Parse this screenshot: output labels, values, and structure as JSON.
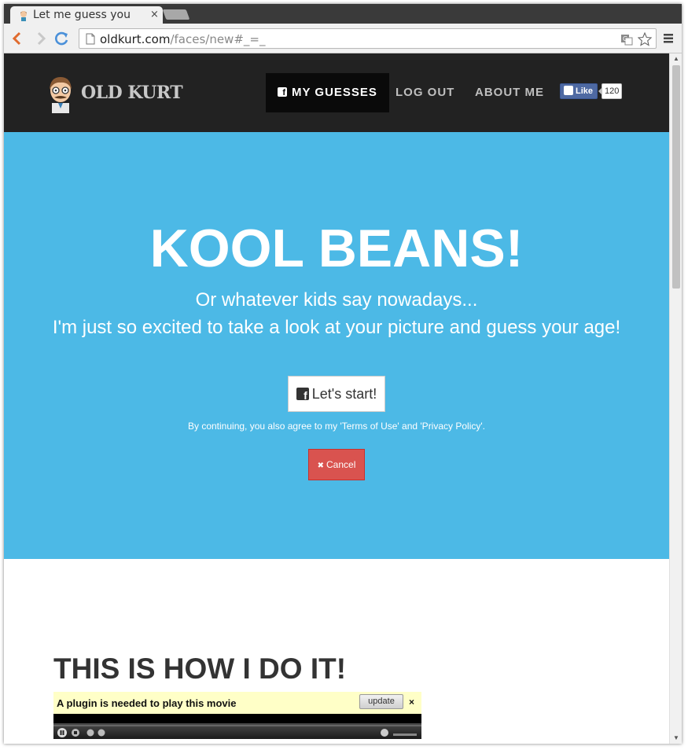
{
  "browser": {
    "tab_title": "Let me guess you",
    "tab_close": "×",
    "url_host": "oldkurt.com",
    "url_path": "/faces/new#_=_"
  },
  "nav": {
    "brand": "OLD KURT",
    "items": [
      {
        "label": "MY GUESSES",
        "active": true
      },
      {
        "label": "LOG OUT",
        "active": false
      },
      {
        "label": "ABOUT ME",
        "active": false
      }
    ],
    "fb_like_label": "Like",
    "fb_like_count": "120"
  },
  "hero": {
    "title": "KOOL BEANS!",
    "subtitle_line1": "Or whatever kids say nowadays...",
    "subtitle_line2": "I'm just so excited to take a look at your picture and guess your age!",
    "start_label": "Let's start!",
    "terms": "By continuing, you also agree to my 'Terms of Use' and 'Privacy Policy'.",
    "cancel_label": "Cancel",
    "cancel_icon": "✖"
  },
  "section": {
    "title": "THIS IS HOW I DO IT!",
    "plugin_message": "A plugin is needed to play this movie",
    "plugin_update": "update",
    "plugin_close": "×"
  },
  "colors": {
    "hero_bg": "#4cb9e6",
    "nav_bg": "#222222",
    "cancel": "#d9534f",
    "fb": "#4e69a2"
  }
}
